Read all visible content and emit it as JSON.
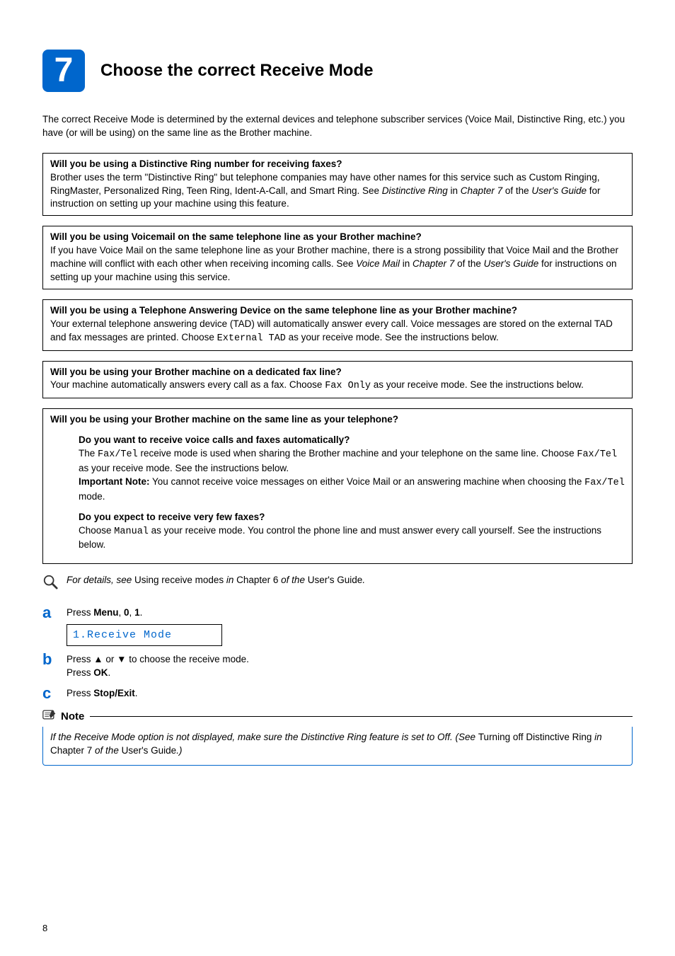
{
  "step_number": "7",
  "title": "Choose the correct Receive Mode",
  "intro": "The correct Receive Mode is determined by the external devices and telephone subscriber services (Voice Mail, Distinctive Ring, etc.) you have (or will be using) on the same line as the Brother machine.",
  "panel1": {
    "title": "Will you be using a Distinctive Ring number for receiving faxes?",
    "body_pre": "Brother uses the term \"Distinctive Ring\" but telephone companies may have other names for this service such as Custom Ringing, RingMaster, Personalized Ring, Teen Ring, Ident-A-Call, and Smart Ring. See ",
    "body_ital1": "Distinctive Ring",
    "body_mid": " in ",
    "body_ital2": "Chapter 7",
    "body_mid2": " of the ",
    "body_ital3": "User's Guide",
    "body_post": " for instruction on setting up your machine using this feature."
  },
  "panel2": {
    "title": "Will you be using Voicemail on the same telephone line as your Brother machine?",
    "body_pre": "If you have Voice Mail on the same telephone line as your Brother machine, there is a strong possibility that Voice Mail and the Brother machine will conflict with each other when receiving incoming calls. See ",
    "body_ital1": "Voice Mail",
    "body_mid": " in ",
    "body_ital2": "Chapter 7",
    "body_mid2": " of the ",
    "body_ital3": "User's Guide",
    "body_post": " for instructions on setting up your machine using this service."
  },
  "panel3": {
    "title": "Will you be using a Telephone Answering Device on the same telephone line as your Brother machine?",
    "body_pre": "Your external telephone answering device (TAD) will automatically answer every call. Voice messages are stored on the external TAD and fax messages are printed. Choose ",
    "mono": "External TAD",
    "body_post": " as your receive mode. See the instructions below."
  },
  "panel4": {
    "title": "Will you be using your Brother machine on a dedicated fax line?",
    "body_pre": "Your machine automatically answers every call as a fax. Choose ",
    "mono": "Fax Only",
    "body_post": " as your receive mode. See the instructions below."
  },
  "panel5": {
    "title": "Will you be using your Brother machine on the same line as your telephone?",
    "sub1": {
      "title": "Do you want to receive voice calls and faxes automatically?",
      "l1_pre": "The ",
      "l1_mono": "Fax/Tel",
      "l1_post": " receive mode is used when sharing the Brother machine and your telephone on the same line. Choose ",
      "l1_mono2": "Fax/Tel",
      "l1_post2": " as your receive mode. See the instructions below.",
      "l2_bold": "Important Note:",
      "l2_post": " You cannot receive voice messages on either Voice Mail or an answering machine when choosing the ",
      "l2_mono": "Fax/Tel",
      "l2_post2": " mode."
    },
    "sub2": {
      "title": "Do you expect to receive very few faxes?",
      "pre": "Choose ",
      "mono": "Manual",
      "post": " as your receive mode. You control the phone line and must answer every call yourself. See the instructions below."
    }
  },
  "detail_ref": {
    "pre": "For details, see ",
    "plain1": "Using receive modes ",
    "mid": "in ",
    "plain2": "Chapter 6 ",
    "mid2": "of the ",
    "plain3": "User's Guide",
    "post": "."
  },
  "steps": {
    "a": {
      "letter": "a",
      "pre": "Press ",
      "b1": "Menu",
      "c1": ", ",
      "b2": "0",
      "c2": ", ",
      "b3": "1",
      "post": ".",
      "lcd": "1.Receive Mode"
    },
    "b": {
      "letter": "b",
      "l1_pre": "Press ",
      "up": "▲",
      "mid": " or ",
      "down": "▼",
      "l1_post": " to choose the receive mode.",
      "l2_pre": "Press ",
      "l2_b": "OK",
      "l2_post": "."
    },
    "c": {
      "letter": "c",
      "pre": "Press ",
      "b": "Stop/Exit",
      "post": "."
    }
  },
  "note": {
    "label": "Note",
    "body_i1": "If the Receive Mode option is not displayed, make sure the Distinctive Ring feature is set to Off. (See ",
    "plain1": "Turning off Distinctive Ring ",
    "i2": "in ",
    "plain2": "Chapter 7 ",
    "i3": "of the ",
    "plain3": "User's Guide",
    "i4": ".)"
  },
  "page_number": "8"
}
